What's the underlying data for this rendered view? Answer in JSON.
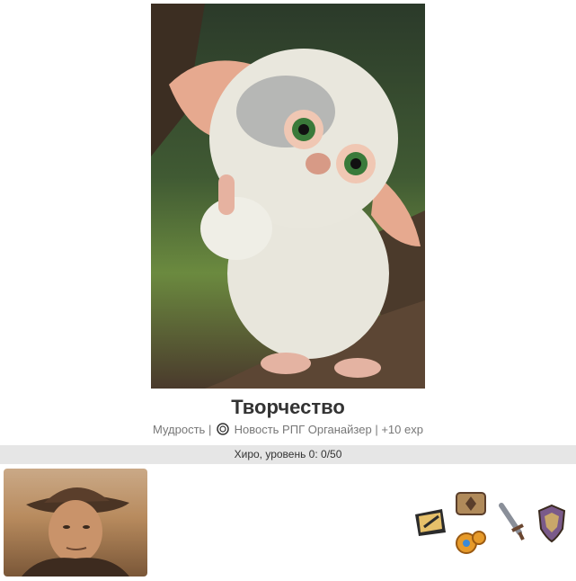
{
  "post": {
    "title": "Творчество",
    "category": "Мудрость",
    "separator": "|",
    "source_link": "Новость РПГ Органайзер",
    "reward": "+10 exp"
  },
  "hero_progress": {
    "text": "Хиро, уровень 0: 0/50",
    "current": 0,
    "max": 50
  },
  "icons": {
    "source": "coin-icon",
    "badges": [
      "quill-badge-icon",
      "scroll-badge-icon",
      "gears-badge-icon",
      "sword-badge-icon",
      "shield-badge-icon"
    ]
  },
  "images": {
    "hero": "fluffy-creature-photo",
    "avatar": "adventurer-portrait"
  },
  "colors": {
    "progress_bg": "#e6e6e6",
    "title": "#333333",
    "meta": "#777777"
  }
}
